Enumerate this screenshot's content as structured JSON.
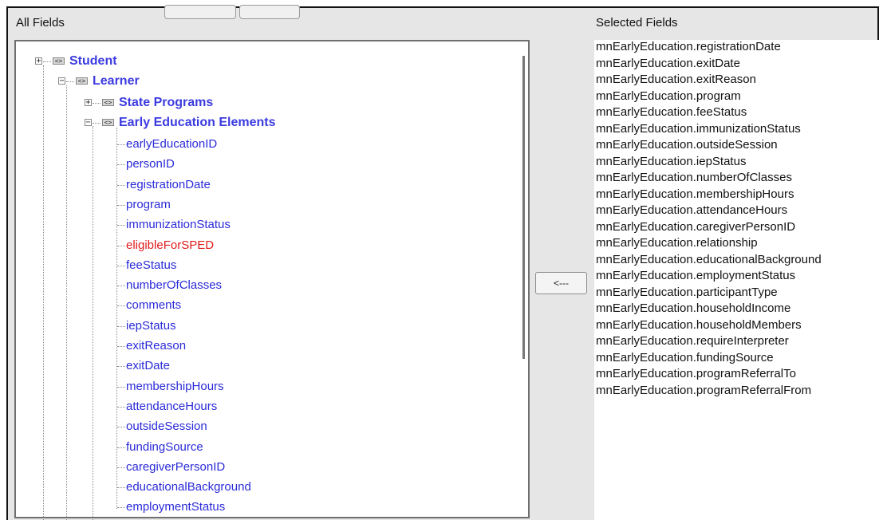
{
  "headers": {
    "all_fields": "All Fields",
    "selected_fields": "Selected Fields"
  },
  "tree": {
    "student": {
      "label": "Student",
      "expander": "+"
    },
    "learner": {
      "label": "Learner",
      "expander": "−"
    },
    "state_programs": {
      "label": "State Programs",
      "expander": "+"
    },
    "early_education": {
      "label": "Early Education Elements",
      "expander": "−"
    },
    "chip_glyph": "<>",
    "leaves": [
      {
        "label": "earlyEducationID",
        "warning": false
      },
      {
        "label": "personID",
        "warning": false
      },
      {
        "label": "registrationDate",
        "warning": false
      },
      {
        "label": "program",
        "warning": false
      },
      {
        "label": "immunizationStatus",
        "warning": false
      },
      {
        "label": "eligibleForSPED",
        "warning": true
      },
      {
        "label": "feeStatus",
        "warning": false
      },
      {
        "label": "numberOfClasses",
        "warning": false
      },
      {
        "label": "comments",
        "warning": false
      },
      {
        "label": "iepStatus",
        "warning": false
      },
      {
        "label": "exitReason",
        "warning": false
      },
      {
        "label": "exitDate",
        "warning": false
      },
      {
        "label": "membershipHours",
        "warning": false
      },
      {
        "label": "attendanceHours",
        "warning": false
      },
      {
        "label": "outsideSession",
        "warning": false
      },
      {
        "label": "fundingSource",
        "warning": false
      },
      {
        "label": "caregiverPersonID",
        "warning": false
      },
      {
        "label": "educationalBackground",
        "warning": false
      },
      {
        "label": "employmentStatus",
        "warning": false
      }
    ]
  },
  "move_button": {
    "label": "<---"
  },
  "selected_fields": [
    "mnEarlyEducation.registrationDate",
    "mnEarlyEducation.exitDate",
    "mnEarlyEducation.exitReason",
    "mnEarlyEducation.program",
    "mnEarlyEducation.feeStatus",
    "mnEarlyEducation.immunizationStatus",
    "mnEarlyEducation.outsideSession",
    "mnEarlyEducation.iepStatus",
    "mnEarlyEducation.numberOfClasses",
    "mnEarlyEducation.membershipHours",
    "mnEarlyEducation.attendanceHours",
    "mnEarlyEducation.caregiverPersonID",
    "mnEarlyEducation.relationship",
    "mnEarlyEducation.educationalBackground",
    "mnEarlyEducation.employmentStatus",
    "mnEarlyEducation.participantType",
    "mnEarlyEducation.householdIncome",
    "mnEarlyEducation.householdMembers",
    "mnEarlyEducation.requireInterpreter",
    "mnEarlyEducation.fundingSource",
    "mnEarlyEducation.programReferralTo",
    "mnEarlyEducation.programReferralFrom"
  ],
  "colors": {
    "node": "#3b3be0",
    "leaf": "#2a2ad8",
    "warning": "#e01b1b",
    "background": "#e6e6e6"
  }
}
